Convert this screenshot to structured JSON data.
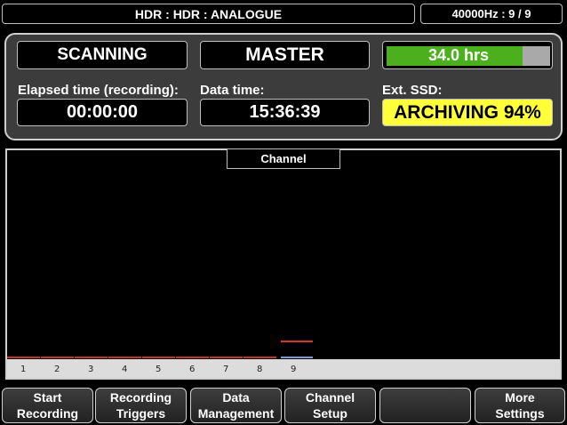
{
  "header": {
    "title": "HDR : HDR : ANALOGUE",
    "rate": "40000Hz : 9 / 9"
  },
  "status": {
    "scan_state": "SCANNING",
    "mode": "MASTER",
    "hours": {
      "text": "34.0 hrs",
      "fraction": 0.83
    },
    "elapsed_label": "Elapsed time (recording):",
    "elapsed_value": "00:00:00",
    "datatime_label": "Data time:",
    "datatime_value": "15:36:39",
    "ssd_label": "Ext. SSD:",
    "ssd_value": "ARCHIVING 94%"
  },
  "chart_data": {
    "type": "bar",
    "title": "Channel",
    "categories": [
      "1",
      "2",
      "3",
      "4",
      "5",
      "6",
      "7",
      "8",
      "9"
    ],
    "selected": "9",
    "colors": {
      "bar": "#c0352b",
      "selected": "#d23a30",
      "underline": "#7b9ad8",
      "fill": "#4caf1e"
    }
  },
  "softkeys": [
    {
      "line1": "Start",
      "line2": "Recording"
    },
    {
      "line1": "Recording",
      "line2": "Triggers"
    },
    {
      "line1": "Data",
      "line2": "Management"
    },
    {
      "line1": "Channel",
      "line2": "Setup"
    },
    {
      "line1": "",
      "line2": ""
    },
    {
      "line1": "More",
      "line2": "Settings"
    }
  ]
}
